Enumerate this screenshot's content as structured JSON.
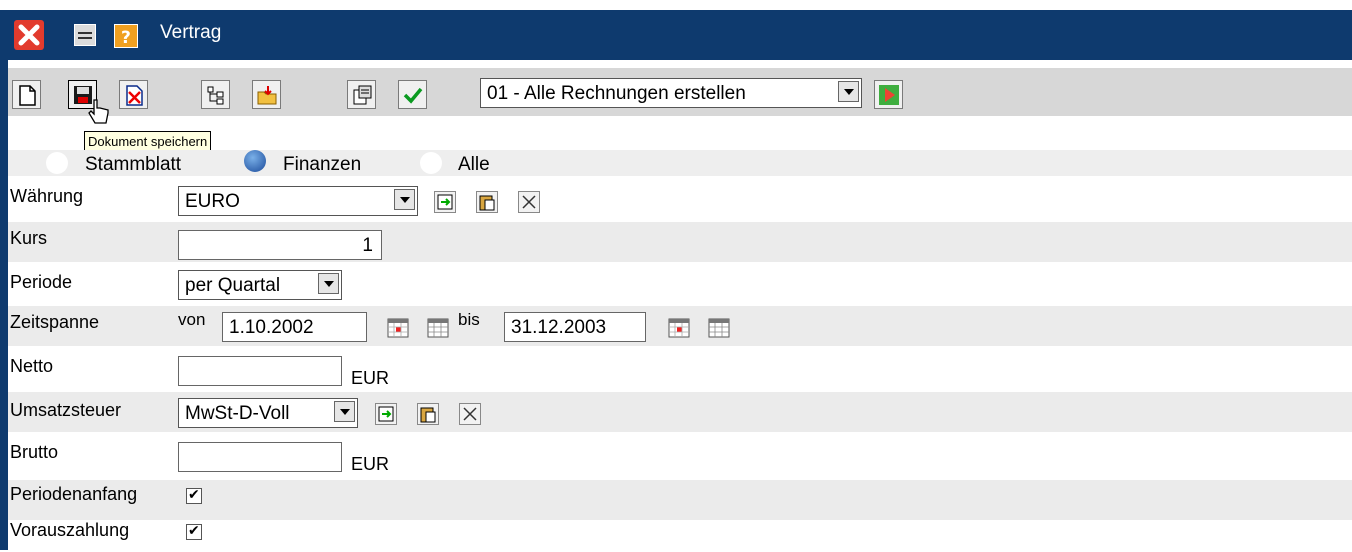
{
  "window": {
    "title": "Vertrag"
  },
  "toolbar": {
    "action_select_value": "01 - Alle Rechnungen erstellen",
    "tooltip": "Dokument speichern"
  },
  "tabs": [
    {
      "label": "Stammblatt"
    },
    {
      "label": "Finanzen"
    },
    {
      "label": "Alle"
    }
  ],
  "form": {
    "waehrung": {
      "label": "Währung",
      "value": "EURO"
    },
    "kurs": {
      "label": "Kurs",
      "value": "1"
    },
    "periode": {
      "label": "Periode",
      "value": "per Quartal"
    },
    "zeitspanne": {
      "label": "Zeitspanne",
      "von_label": "von",
      "von_value": "1.10.2002",
      "bis_label": "bis",
      "bis_value": "31.12.2003"
    },
    "netto": {
      "label": "Netto",
      "value": "",
      "unit": "EUR"
    },
    "umsatzsteuer": {
      "label": "Umsatzsteuer",
      "value": "MwSt-D-Voll"
    },
    "brutto": {
      "label": "Brutto",
      "value": "",
      "unit": "EUR"
    },
    "periodenanfang": {
      "label": "Periodenanfang",
      "checked": true
    },
    "vorauszahlung": {
      "label": "Vorauszahlung",
      "checked": true
    }
  },
  "colors": {
    "titlebar": "#0e3a6e",
    "toolbar": "#d7d7d7",
    "row_shade": "#ebebeb",
    "tooltip_bg": "#ffffe1"
  }
}
